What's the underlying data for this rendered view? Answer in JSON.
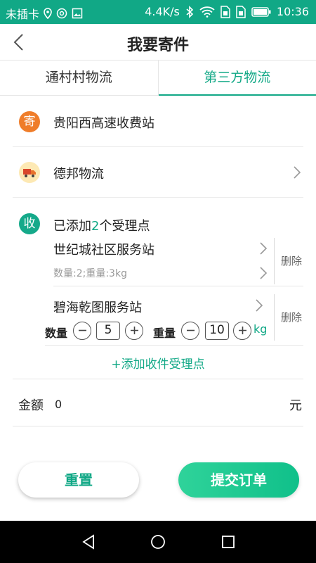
{
  "status_bar": {
    "carrier": "未插卡",
    "speed": "4.4K/s",
    "time": "10:36"
  },
  "header": {
    "title": "我要寄件"
  },
  "tabs": [
    {
      "label": "通村村物流",
      "active": false
    },
    {
      "label": "第三方物流",
      "active": true
    }
  ],
  "sender": {
    "badge": "寄",
    "address": "贵阳西高速收费站"
  },
  "logistics": {
    "company": "德邦物流"
  },
  "receiver": {
    "badge": "收",
    "summary_prefix": "已添加",
    "count": "2",
    "summary_suffix": "个受理点",
    "points": [
      {
        "name": "世纪城社区服务站",
        "detail": "数量:2;重量:3kg",
        "delete_label": "删除"
      },
      {
        "name": "碧海乾图服务站",
        "delete_label": "删除",
        "qty_label": "数量",
        "qty_value": "5",
        "weight_label": "重量",
        "weight_value": "10",
        "weight_unit": "kg"
      }
    ],
    "add_label": "+添加收件受理点"
  },
  "amount": {
    "label": "金额",
    "value": "0",
    "unit": "元"
  },
  "buttons": {
    "reset": "重置",
    "submit": "提交订单"
  },
  "colors": {
    "accent": "#11a886",
    "sender_badge": "#ef7d2a",
    "receiver_badge": "#15a98a",
    "logistics_icon_bg": "#fde9b4"
  },
  "icons": {
    "back": "back-arrow-icon",
    "chevron": "chevron-right-icon",
    "truck": "truck-icon",
    "minus": "minus-icon",
    "plus": "plus-icon"
  }
}
